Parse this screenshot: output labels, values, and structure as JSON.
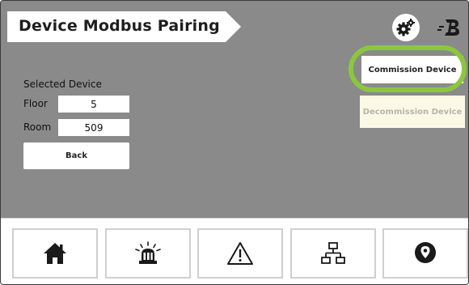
{
  "header": {
    "title": "Device Modbus Pairing",
    "settings_icon": "gear-icon",
    "logo_icon": "brand-b-logo"
  },
  "actions": {
    "commission_label": "Commission Device",
    "decommission_label": "Decommission Device",
    "highlight_color": "#8cc63f"
  },
  "selected_device": {
    "heading": "Selected Device",
    "floor_label": "Floor",
    "floor_value": "5",
    "room_label": "Room",
    "room_value": "509",
    "back_label": "Back"
  },
  "bottom_nav": {
    "items": [
      {
        "icon": "home-icon"
      },
      {
        "icon": "alarm-beacon-icon"
      },
      {
        "icon": "warning-icon"
      },
      {
        "icon": "network-icon"
      },
      {
        "icon": "location-pin-icon"
      }
    ]
  },
  "colors": {
    "background": "#8a8a8a",
    "banner": "#ffffff",
    "decommission_bg": "#fbf8e6"
  }
}
